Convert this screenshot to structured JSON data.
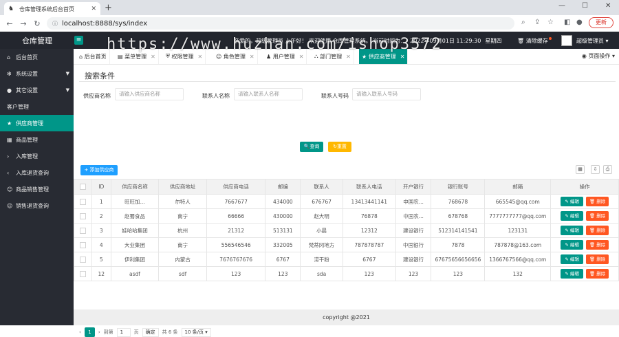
{
  "browser": {
    "tab_title": "仓库管理系统后台首页",
    "url": "localhost:8888/sys/index",
    "update_label": "更新"
  },
  "topbar": {
    "brand": "仓库管理",
    "greeting": "亲爱的，超级管理员 上午好！ 欢迎使用 仓库管理系统。 当前时间为：",
    "datetime": "2022年09月01日 11:29:30",
    "weekday": "星期四",
    "clear_cache": "清除缓存",
    "user": "超级管理员"
  },
  "watermark": "https://www.huzhan.com/ishop3572",
  "sidebar": {
    "items": [
      {
        "label": "后台首页",
        "icon": "home-icon"
      },
      {
        "label": "系统设置",
        "icon": "gear-icon"
      },
      {
        "label": "其它设置",
        "icon": "circle-icon"
      },
      {
        "label": "客户管理",
        "icon": ""
      },
      {
        "label": "供应商管理",
        "icon": "star-icon"
      },
      {
        "label": "商品管理",
        "icon": "grid-icon"
      },
      {
        "label": "入库管理",
        "icon": "chevron-right-icon"
      },
      {
        "label": "入库退货查询",
        "icon": "chevron-left-icon"
      },
      {
        "label": "商品销售管理",
        "icon": "users-icon"
      },
      {
        "label": "销售退货查询",
        "icon": "users-icon"
      }
    ]
  },
  "tabs": {
    "items": [
      {
        "label": "后台首页"
      },
      {
        "label": "菜单管理"
      },
      {
        "label": "权限管理"
      },
      {
        "label": "角色管理"
      },
      {
        "label": "用户管理"
      },
      {
        "label": "部门管理"
      },
      {
        "label": "供应商管理"
      }
    ],
    "page_ops": "页面操作"
  },
  "search": {
    "section_title": "搜索条件",
    "supplier_label": "供应商名称",
    "supplier_placeholder": "请输入供应商名称",
    "contact_label": "联系人名称",
    "contact_placeholder": "请输入联系人名称",
    "phone_label": "联系人号码",
    "phone_placeholder": "请输入联系人号码",
    "query_btn": "查询",
    "reset_btn": "重置"
  },
  "toolbar": {
    "add_label": "添加供应商"
  },
  "table": {
    "headers": [
      "ID",
      "供应商名称",
      "供应商地址",
      "供应商电话",
      "邮编",
      "联系人",
      "联系人电话",
      "开户银行",
      "银行账号",
      "邮箱",
      "操作"
    ],
    "rows": [
      [
        "1",
        "旺旺加...",
        "尔特人",
        "7667677",
        "434000",
        "676767",
        "13413441141",
        "中国农...",
        "768678",
        "665545@qq.com"
      ],
      [
        "2",
        "赵蜀食品",
        "南宁",
        "66666",
        "430000",
        "赵大明",
        "76878",
        "中国农...",
        "678768",
        "7777777777@qq.com"
      ],
      [
        "3",
        "娃哈哈集团",
        "杭州",
        "21312",
        "513131",
        "小晨",
        "12312",
        "建设银行",
        "512314141541",
        "123131"
      ],
      [
        "4",
        "大业集团",
        "南宁",
        "556546546",
        "332005",
        "梵蒂冈地方",
        "787878787",
        "中国银行",
        "7878",
        "787878@163.com"
      ],
      [
        "5",
        "伊利集团",
        "内蒙古",
        "7676767676",
        "6767",
        "涝干粉",
        "6767",
        "建设银行",
        "67675656656656",
        "1366767566@qq.com"
      ],
      [
        "12",
        "asdf",
        "sdf",
        "123",
        "123",
        "sda",
        "123",
        "123",
        "123",
        "132"
      ]
    ],
    "edit_label": "编辑",
    "delete_label": "删除"
  },
  "pager": {
    "current": "1",
    "goto_label": "到第",
    "goto_value": "1",
    "page_unit": "页",
    "confirm": "确定",
    "total": "共 6 条",
    "per_page": "10 条/页"
  },
  "footer": "copyright @2021"
}
